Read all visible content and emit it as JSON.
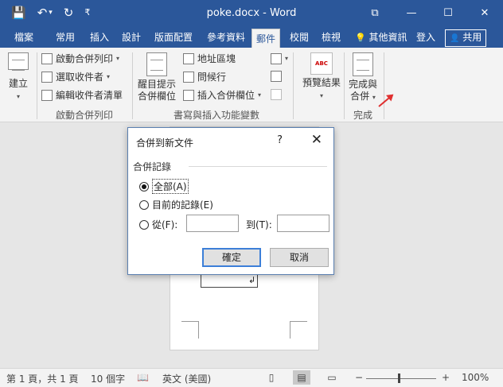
{
  "titlebar": {
    "doc_title": "poke.docx - Word",
    "qat": {
      "save_icon": "💾",
      "undo_icon": "↶",
      "undo_caret": "▾",
      "redo_icon": "↻",
      "customize_icon": "₹"
    },
    "controls": {
      "ribbon_options": "⧉",
      "minimize": "—",
      "restore": "☐",
      "close": "✕"
    }
  },
  "tabs": {
    "file": "檔案",
    "items": [
      "常用",
      "插入",
      "設計",
      "版面配置",
      "參考資料",
      "郵件",
      "校閱",
      "檢視"
    ],
    "active": "郵件",
    "tell_me": "其他資訊",
    "tell_me_icon": "💡",
    "sign_in": "登入",
    "share": "共用",
    "share_icon": "👤"
  },
  "ribbon": {
    "create": {
      "label": "建立"
    },
    "start_merge_group": {
      "label": "啟動合併列印",
      "start_merge": "啟動合併列印",
      "select_recipients": "選取收件者",
      "edit_recipient_list": "編輯收件者清單"
    },
    "write_insert_group": {
      "label": "書寫與插入功能變數",
      "highlight_merge_fields": "醒目提示\n合併欄位",
      "address_block": "地址區塊",
      "greeting_line": "問候行",
      "insert_merge_field": "插入合併欄位"
    },
    "preview_group": {
      "preview_results": "預覽結果",
      "abc": "ABC"
    },
    "finish_group": {
      "label": "完成",
      "finish_merge": "完成與\n合併"
    }
  },
  "dialog": {
    "title": "合併到新文件",
    "help": "?",
    "close": "✕",
    "group_label": "合併記錄",
    "options": [
      {
        "label": "全部(A)",
        "selected": true
      },
      {
        "label": "目前的記錄(E)",
        "selected": false
      },
      {
        "label": "從(F):",
        "selected": false
      }
    ],
    "from_value": "",
    "to_label": "到(T):",
    "to_value": "",
    "ok": "確定",
    "cancel": "取消"
  },
  "document": {
    "field_mark": "↲"
  },
  "statusbar": {
    "page": "第 1 頁，共 1 頁",
    "words": "10 個字",
    "proofing_icon": "📖",
    "language": "英文 (美國)",
    "zoom": "100%",
    "zoom_minus": "−",
    "zoom_plus": "+"
  }
}
